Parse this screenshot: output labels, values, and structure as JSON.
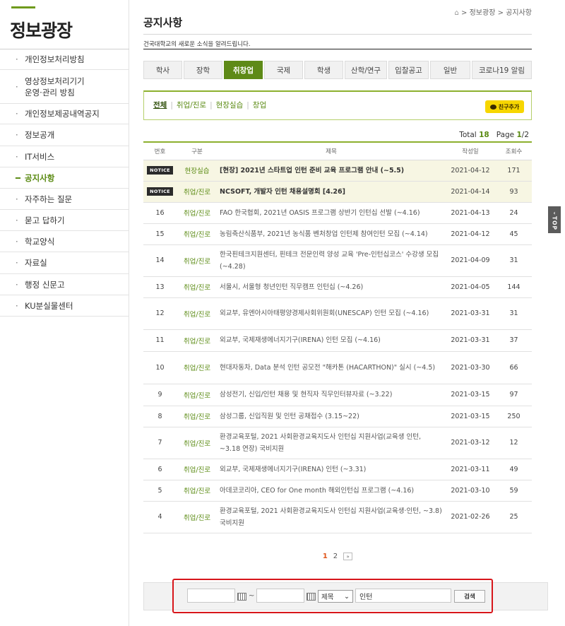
{
  "sidebar": {
    "title": "정보광장",
    "bullet": "·",
    "active_bullet": "━",
    "items": [
      {
        "label": "개인정보처리방침"
      },
      {
        "label": "영상정보처리기기\n운영·관리 방침"
      },
      {
        "label": "개인정보제공내역공지"
      },
      {
        "label": "정보공개"
      },
      {
        "label": "IT서비스"
      },
      {
        "label": "공지사항",
        "active": true
      },
      {
        "label": "자주하는 질문"
      },
      {
        "label": "묻고 답하기"
      },
      {
        "label": "학교양식"
      },
      {
        "label": "자료실"
      },
      {
        "label": "행정 신문고"
      },
      {
        "label": "KU분실물센터"
      }
    ]
  },
  "breadcrumb": {
    "sep": ">",
    "items": [
      "정보광장",
      "공지사항"
    ]
  },
  "header": {
    "title": "공지사항",
    "subtitle": "건국대학교의 새로운 소식을 알려드립니다."
  },
  "tabs": [
    {
      "label": "학사"
    },
    {
      "label": "장학"
    },
    {
      "label": "취창업",
      "active": true
    },
    {
      "label": "국제"
    },
    {
      "label": "학생"
    },
    {
      "label": "산학/연구"
    },
    {
      "label": "입찰공고"
    },
    {
      "label": "일반"
    },
    {
      "label": "코로나19 알림"
    }
  ],
  "subfilters": {
    "items": [
      {
        "label": "전체",
        "active": true
      },
      {
        "label": "취업/진로"
      },
      {
        "label": "현장실습"
      },
      {
        "label": "창업"
      }
    ],
    "kakao_label": "친구추가"
  },
  "counts": {
    "total_label": "Total",
    "total": "18",
    "page_label": "Page",
    "page_current": "1",
    "page_total": "/2"
  },
  "board": {
    "columns": [
      "번호",
      "구분",
      "제목",
      "작성일",
      "조회수"
    ],
    "notice_label": "NOTICE",
    "rows": [
      {
        "notice": true,
        "num": "",
        "cat": "현장실습",
        "title": "[현장] 2021년 스타트업 인턴 준비 교육 프로그램 안내 (~5.5)",
        "date": "2021-04-12",
        "views": "171"
      },
      {
        "notice": true,
        "num": "",
        "cat": "취업/진로",
        "title": "NCSOFT, 개발자 인턴 채용설명회 [4.26]",
        "date": "2021-04-14",
        "views": "93"
      },
      {
        "num": "16",
        "cat": "취업/진로",
        "title": "FAO 한국협회, 2021년 OASIS 프로그램 상반기 인턴십 선발 (~4.16)",
        "date": "2021-04-13",
        "views": "24"
      },
      {
        "num": "15",
        "cat": "취업/진로",
        "title": "농림축산식품부, 2021년 농식품 벤처창업 인턴제 참여인턴 모집 (~4.14)",
        "date": "2021-04-12",
        "views": "45"
      },
      {
        "num": "14",
        "cat": "취업/진로",
        "title": "한국핀테크지원센터, 핀테크 전문인력 양성 교육 'Pre-인턴십코스' 수강생 모집 (~4.28)",
        "date": "2021-04-09",
        "views": "31"
      },
      {
        "num": "13",
        "cat": "취업/진로",
        "title": "서울시, 서울형 청년인턴 직무캠프 인턴십 (~4.26)",
        "date": "2021-04-05",
        "views": "144"
      },
      {
        "num": "12",
        "cat": "취업/진로",
        "title": "외교부, 유엔아시아태평양경제사회위원회(UNESCAP) 인턴 모집 (~4.16)",
        "date": "2021-03-31",
        "views": "31"
      },
      {
        "num": "11",
        "cat": "취업/진로",
        "title": "외교부, 국제재생에너지기구(IRENA) 인턴 모집 (~4.16)",
        "date": "2021-03-31",
        "views": "37"
      },
      {
        "num": "10",
        "cat": "취업/진로",
        "title": "현대자동차, Data 분석 인턴 공모전 \"해카톤 (HACARTHON)\" 실시 (~4.5)",
        "date": "2021-03-30",
        "views": "66"
      },
      {
        "num": "9",
        "cat": "취업/진로",
        "title": "삼성전기, 신입/인턴 채용 및 현직자 직무인터뷰자료 (~3.22)",
        "date": "2021-03-15",
        "views": "97"
      },
      {
        "num": "8",
        "cat": "취업/진로",
        "title": "삼성그룹, 신입직원 및 인턴 공채접수 (3.15~22)",
        "date": "2021-03-15",
        "views": "250"
      },
      {
        "num": "7",
        "cat": "취업/진로",
        "title": "환경교육포털, 2021 사회환경교육지도사 인턴십 지원사업(교육생 인턴, ~3.18 연장) 국비지원",
        "date": "2021-03-12",
        "views": "12"
      },
      {
        "num": "6",
        "cat": "취업/진로",
        "title": "외교부, 국제재생에너지기구(IRENA) 인턴 (~3.31)",
        "date": "2021-03-11",
        "views": "49"
      },
      {
        "num": "5",
        "cat": "취업/진로",
        "title": "아데코코리아, CEO for One month 해외인턴십 프로그램 (~4.16)",
        "date": "2021-03-10",
        "views": "59"
      },
      {
        "num": "4",
        "cat": "취업/진로",
        "title": "환경교육포털, 2021 사회환경교육지도사 인턴십 지원사업(교육생·인턴, ~3.8) 국비지원",
        "date": "2021-02-26",
        "views": "25"
      }
    ]
  },
  "pagination": {
    "pages": [
      "1",
      "2"
    ],
    "current": "1",
    "next_label": "»"
  },
  "search": {
    "date_from": "",
    "tilde": "~",
    "date_to": "",
    "field_value": "제목",
    "keyword": "인턴",
    "button_label": "검색"
  },
  "top_button": {
    "label": "TOP",
    "arrow": "‹"
  }
}
